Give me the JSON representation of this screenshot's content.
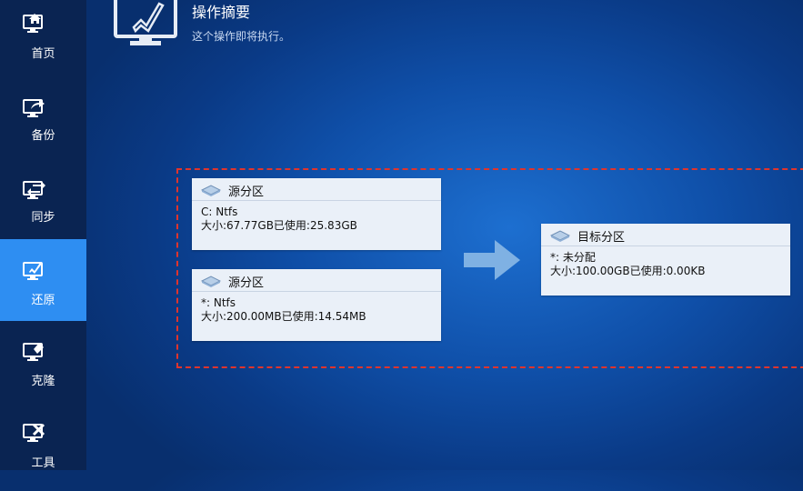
{
  "sidebar": {
    "items": [
      {
        "label": "首页",
        "icon": "home-monitor-icon"
      },
      {
        "label": "备份",
        "icon": "backup-monitor-icon"
      },
      {
        "label": "同步",
        "icon": "sync-monitor-icon"
      },
      {
        "label": "还原",
        "icon": "restore-monitor-icon",
        "active": true
      },
      {
        "label": "克隆",
        "icon": "clone-monitor-icon"
      },
      {
        "label": "工具",
        "icon": "tools-monitor-icon"
      }
    ]
  },
  "summary": {
    "title": "操作摘要",
    "subtitle": "这个操作即将执行。"
  },
  "source_partitions": [
    {
      "header": "源分区",
      "name": "C: Ntfs",
      "size": "大小:67.77GB已使用:25.83GB"
    },
    {
      "header": "源分区",
      "name": "*: Ntfs",
      "size": "大小:200.00MB已使用:14.54MB"
    }
  ],
  "target_partition": {
    "header": "目标分区",
    "name": "*: 未分配",
    "size": "大小:100.00GB已使用:0.00KB"
  },
  "colors": {
    "sidebar_bg": "#0a2452",
    "active_item": "#2e8ef2",
    "dashed_border": "#e0342c",
    "card_bg": "#eaf0f8"
  }
}
